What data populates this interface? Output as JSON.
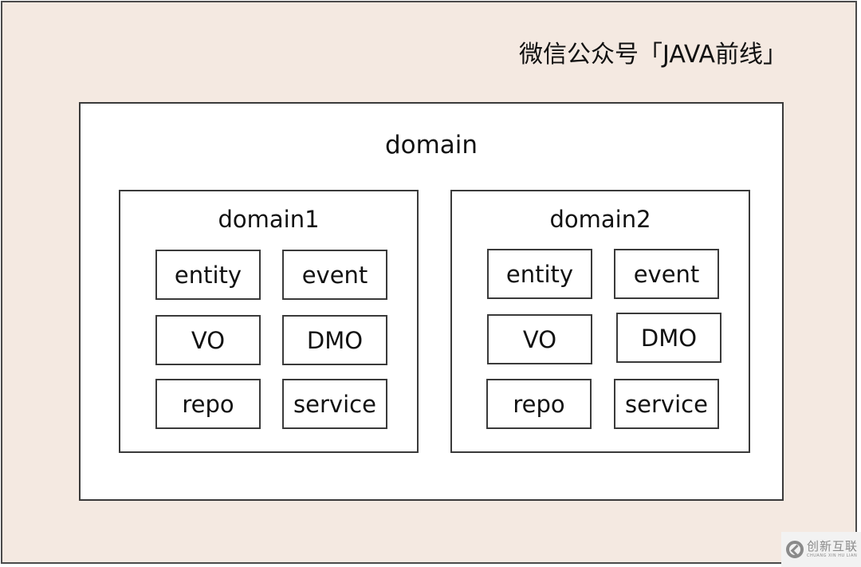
{
  "header": {
    "title": "微信公众号「JAVA前线」"
  },
  "diagram": {
    "outer_label": "domain",
    "domains": [
      {
        "label": "domain1",
        "cells": [
          "entity",
          "event",
          "VO",
          "DMO",
          "repo",
          "service"
        ]
      },
      {
        "label": "domain2",
        "cells": [
          "entity",
          "event",
          "VO",
          "DMO",
          "repo",
          "service"
        ]
      }
    ]
  },
  "watermark": {
    "brand_cn": "创新互联",
    "brand_en": "CHUANG XIN HU LIAN",
    "icon": "brand-logo-icon"
  },
  "colors": {
    "background": "#f4e9e1",
    "box_fill": "#ffffff",
    "border": "#3a3a3a"
  }
}
